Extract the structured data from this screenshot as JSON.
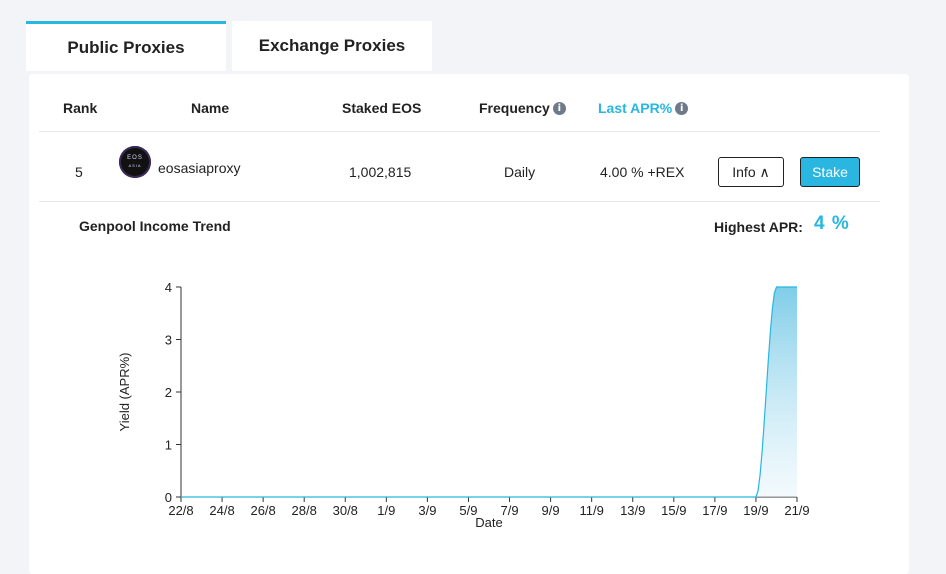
{
  "tabs": [
    {
      "label": "Public Proxies",
      "active": true
    },
    {
      "label": "Exchange Proxies",
      "active": false
    }
  ],
  "table": {
    "headers": {
      "rank": "Rank",
      "name": "Name",
      "staked": "Staked EOS",
      "frequency": "Frequency",
      "apr": "Last APR%"
    },
    "row": {
      "rank": "5",
      "name": "eosasiaproxy",
      "logo_text_top": "EOS",
      "logo_text_bottom": "ASIA",
      "staked": "1,002,815",
      "frequency": "Daily",
      "apr": "4.00 % +REX",
      "info_button": "Info ∧",
      "stake_button": "Stake"
    }
  },
  "trend": {
    "title": "Genpool Income Trend",
    "highest_label": "Highest APR:",
    "highest_value": "4 %"
  },
  "colors": {
    "accent": "#29b6e0",
    "info_icon": "#6e7a89"
  },
  "chart_data": {
    "type": "area",
    "xlabel": "Date",
    "ylabel": "Yield (APR%)",
    "ylim": [
      0,
      4
    ],
    "yticks": [
      0,
      1,
      2,
      3,
      4
    ],
    "xticks": [
      "22/8",
      "24/8",
      "26/8",
      "28/8",
      "30/8",
      "1/9",
      "3/9",
      "5/9",
      "7/9",
      "9/9",
      "11/9",
      "13/9",
      "15/9",
      "17/9",
      "19/9",
      "21/9"
    ],
    "series": [
      {
        "x": [
          "22/8",
          "23/8",
          "24/8",
          "25/8",
          "26/8",
          "27/8",
          "28/8",
          "29/8",
          "30/8",
          "31/8",
          "1/9",
          "2/9",
          "3/9",
          "4/9",
          "5/9",
          "6/9",
          "7/9",
          "8/9",
          "9/9",
          "10/9",
          "11/9",
          "12/9",
          "13/9",
          "14/9",
          "15/9",
          "16/9",
          "17/9",
          "18/9",
          "19/9",
          "20/9",
          "21/9"
        ],
        "values": [
          0,
          0,
          0,
          0,
          0,
          0,
          0,
          0,
          0,
          0,
          0,
          0,
          0,
          0,
          0,
          0,
          0,
          0,
          0,
          0,
          0,
          0,
          0,
          0,
          0,
          0,
          0,
          0,
          0,
          4,
          4
        ]
      }
    ],
    "grid": false,
    "legend": "none"
  }
}
